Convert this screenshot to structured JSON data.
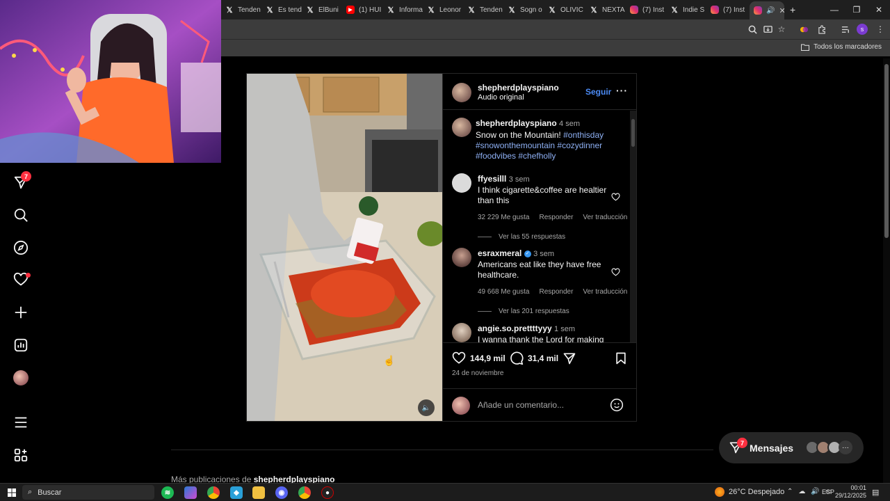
{
  "browser": {
    "tabs": [
      {
        "label": "Tenden",
        "icon": "x-icon"
      },
      {
        "label": "Es tend",
        "icon": "x-icon"
      },
      {
        "label": "ElBuni",
        "icon": "x-icon"
      },
      {
        "label": "(1) HUI",
        "icon": "youtube-icon"
      },
      {
        "label": "Informa",
        "icon": "x-icon"
      },
      {
        "label": "Leonor",
        "icon": "x-icon"
      },
      {
        "label": "Tenden",
        "icon": "x-icon"
      },
      {
        "label": "Sogn o",
        "icon": "x-icon"
      },
      {
        "label": "OLIVIC",
        "icon": "x-icon"
      },
      {
        "label": "NEXTA",
        "icon": "x-icon"
      },
      {
        "label": "(7) Inst",
        "icon": "instagram-icon"
      },
      {
        "label": "Indie S",
        "icon": "x-icon"
      },
      {
        "label": "(7) Inst",
        "icon": "instagram-icon"
      }
    ],
    "bookmarks_all": "Todos los marcadores",
    "profile_initial": "s"
  },
  "sidebar": {
    "notifications_count": "7"
  },
  "post": {
    "author": "shepherdplayspiano",
    "audio": "Audio original",
    "follow": "Seguir",
    "caption": {
      "author": "shepherdplayspiano",
      "time": "4 sem",
      "text": "Snow on the Mountain!",
      "tags_line1": "#onthisday",
      "tags_line2": "#snowonthemountain #cozydinner",
      "tags_line3": "#foodvibes #chefholly"
    },
    "comments": [
      {
        "user": "ffyesilll",
        "time": "3 sem",
        "text1": "I think cigarette&coffee are healtier",
        "text2": "than this",
        "likes": "32 229 Me gusta",
        "reply": "Responder",
        "translate": "Ver traducción",
        "replies": "Ver las 55 respuestas"
      },
      {
        "user": "esraxmeral",
        "time": "3 sem",
        "text1": "Americans eat like they have free",
        "text2": "healthcare.",
        "likes": "49 668 Me gusta",
        "reply": "Responder",
        "translate": "Ver traducción",
        "replies": "Ver las 201 respuestas"
      },
      {
        "user": "angie.so.prettttyyy",
        "time": "1 sem",
        "text1": "I wanna thank the Lord for making"
      }
    ],
    "likes": "144,9 mil",
    "comments_count": "31,4 mil",
    "date": "24 de noviembre",
    "add_comment": "Añade un comentario..."
  },
  "more_posts": {
    "label": "Más publicaciones de",
    "user": "shepherdplayspiano"
  },
  "messages": {
    "label": "Mensajes",
    "count": "7"
  },
  "taskbar": {
    "search": "Buscar",
    "weather": "26°C  Despejado",
    "lang": "ESP",
    "time": "00:01",
    "date": "29/12/2025"
  }
}
